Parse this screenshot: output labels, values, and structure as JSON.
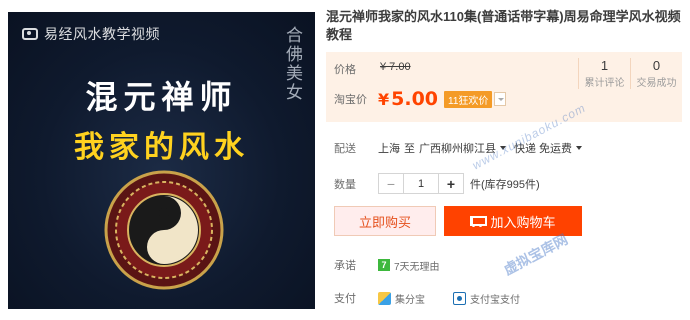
{
  "image": {
    "watermark": "易经风水教学视频",
    "side_text": "合佛美女",
    "title_line1": "混元禅师",
    "title_line2": "我家的风水"
  },
  "product": {
    "title": "混元禅师我家的风水110集(普通话带字幕)周易命理学风水视频教程"
  },
  "price": {
    "orig_label": "价格",
    "orig_value": "¥ 7.00",
    "promo_label": "淘宝价",
    "currency": "¥",
    "promo_value": "5.00",
    "badge": "11狂欢价"
  },
  "stats": [
    {
      "num": "1",
      "label": "累计评论"
    },
    {
      "num": "0",
      "label": "交易成功"
    }
  ],
  "shipping": {
    "label": "配送",
    "from": "上海",
    "to_word": "至",
    "to": "广西柳州柳江县",
    "method": "快递 免运费"
  },
  "quantity": {
    "label": "数量",
    "minus": "−",
    "value": "1",
    "plus": "+",
    "stock": "件(库存995件)"
  },
  "actions": {
    "buy": "立即购买",
    "cart": "加入购物车"
  },
  "commitment": {
    "label": "承诺",
    "icon_glyph": "7",
    "text": "7天无理由"
  },
  "payment": {
    "label": "支付",
    "methods": [
      "集分宝",
      "支付宝支付"
    ]
  },
  "watermarks": {
    "site": "www.xunibaoku.com",
    "site_cn": "虚拟宝库网"
  },
  "colors": {
    "price_orange": "#ff4400",
    "cart_button": "#ff4200",
    "price_bg": "#fef1e6"
  }
}
